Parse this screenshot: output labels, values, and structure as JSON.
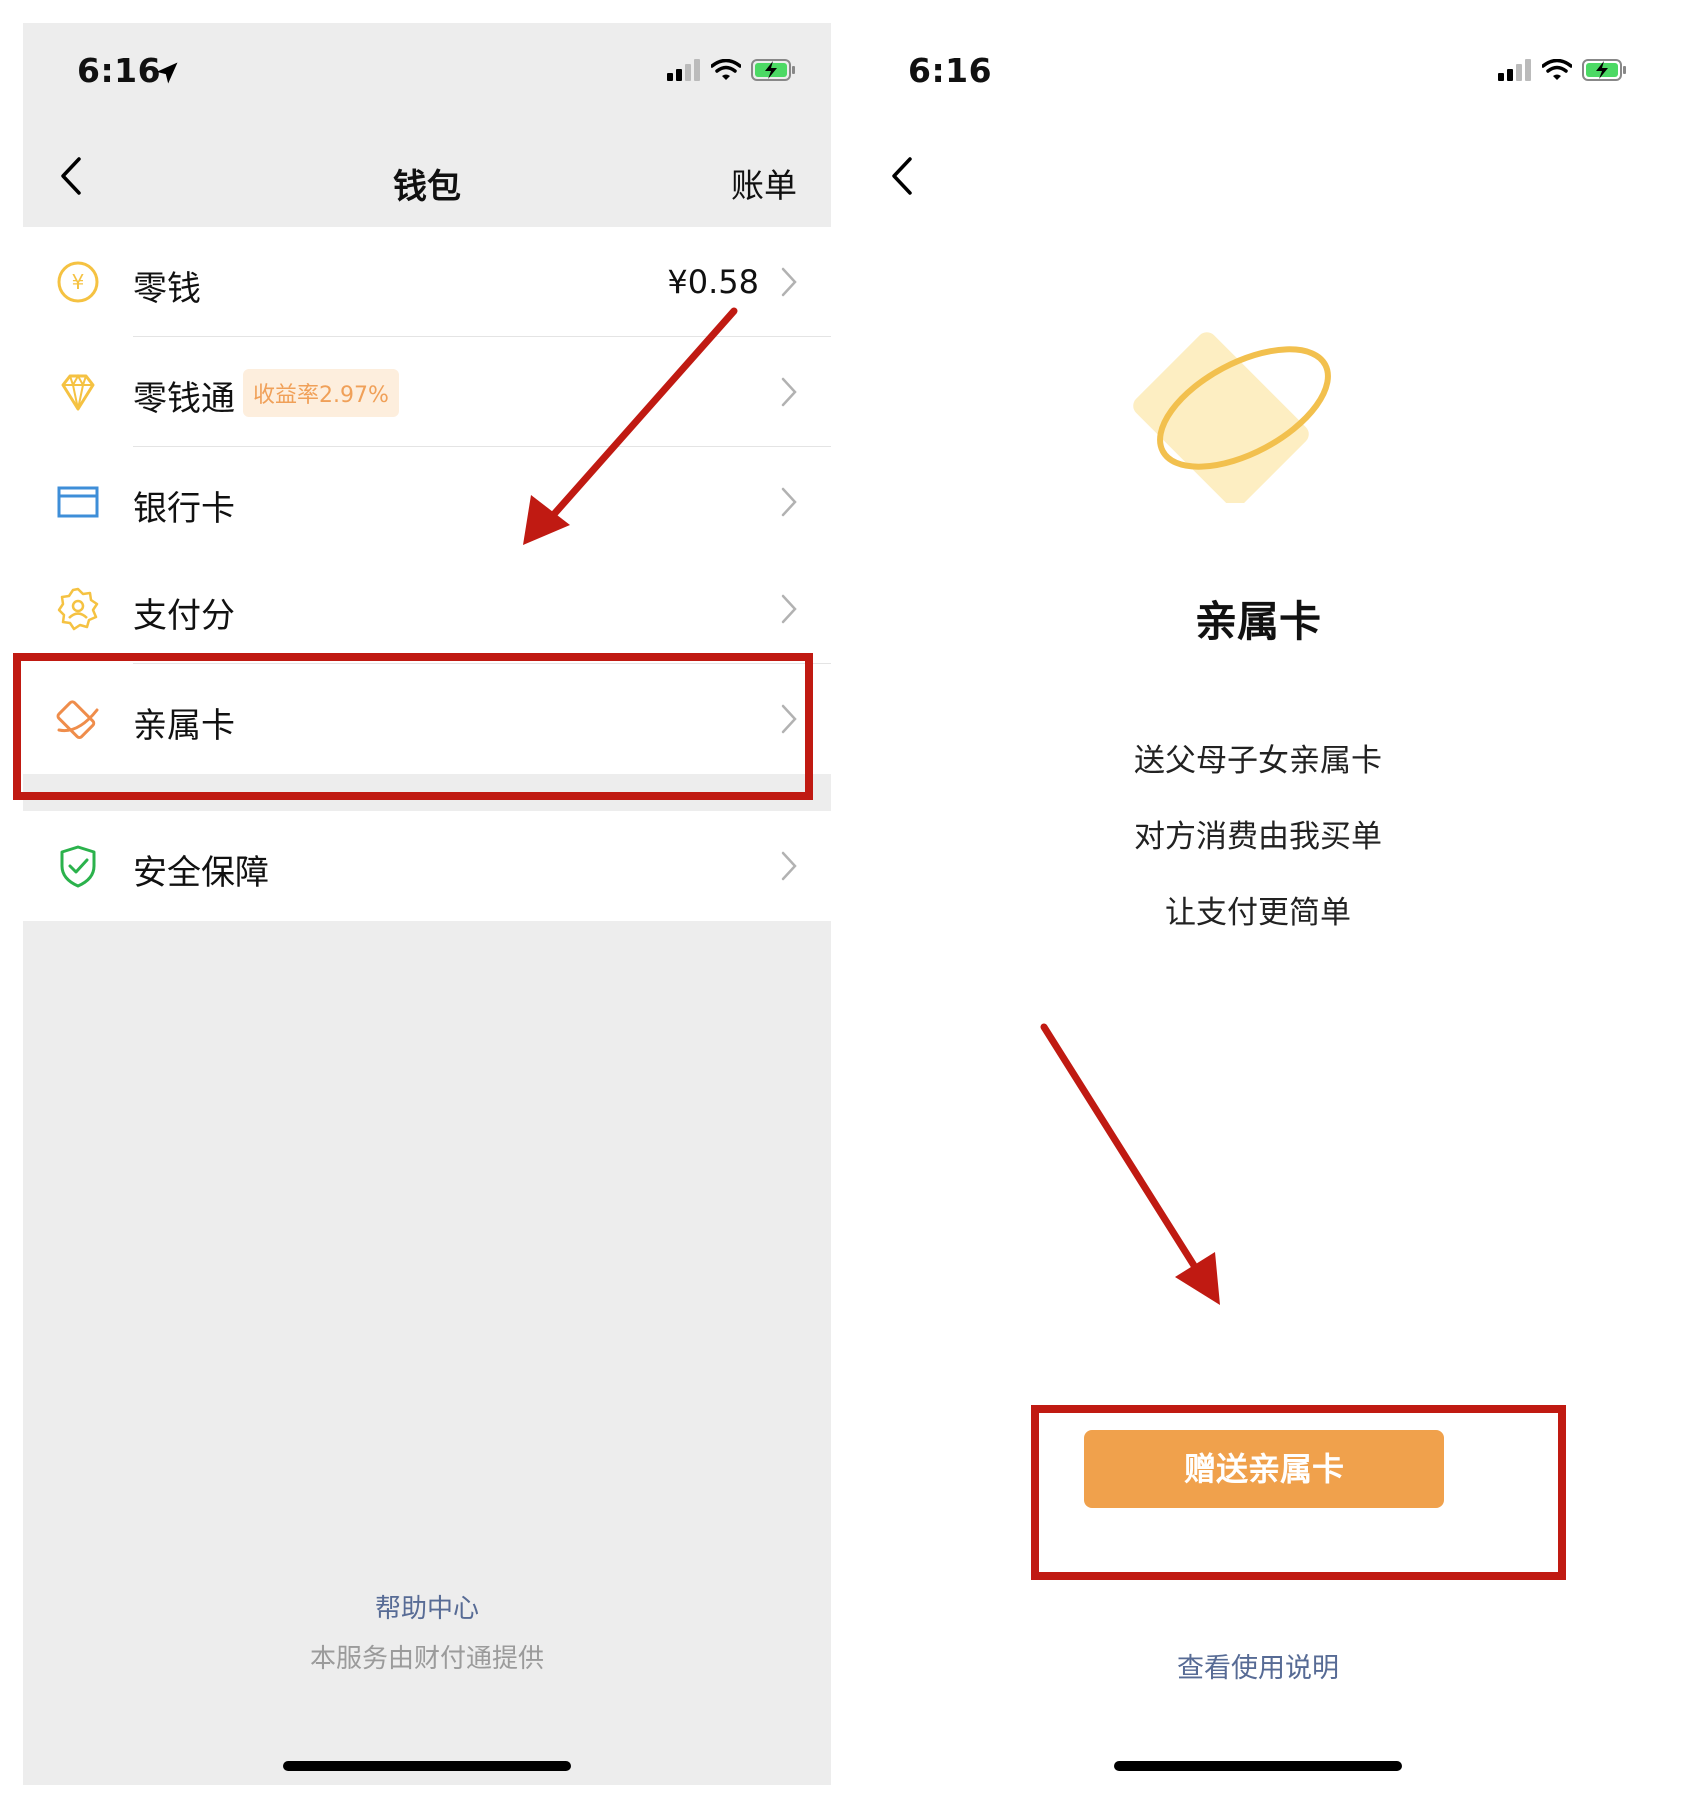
{
  "colors": {
    "accent": "#f0a14c",
    "link": "#576b95",
    "annotation": "#c01a12",
    "divider": "#e4e4e4",
    "page_bg": "#ededed"
  },
  "left_screen": {
    "status": {
      "time": "6:16"
    },
    "nav": {
      "title": "钱包",
      "right_action": "账单"
    },
    "rows": [
      {
        "icon": "yen-coin-icon",
        "label": "零钱",
        "value": "¥0.58"
      },
      {
        "icon": "diamond-icon",
        "label": "零钱通",
        "badge": "收益率2.97%"
      },
      {
        "icon": "bank-card-icon",
        "label": "银行卡"
      },
      {
        "icon": "pay-score-icon",
        "label": "支付分"
      },
      {
        "icon": "family-card-icon",
        "label": "亲属卡"
      },
      {
        "icon": "shield-check-icon",
        "label": "安全保障"
      }
    ],
    "footer": {
      "help": "帮助中心",
      "provider": "本服务由财付通提供"
    }
  },
  "right_screen": {
    "status": {
      "time": "6:16"
    },
    "title": "亲属卡",
    "description_lines": [
      "送父母子女亲属卡",
      "对方消费由我买单",
      "让支付更简单"
    ],
    "primary_button": "赠送亲属卡",
    "secondary_link": "查看使用说明"
  }
}
